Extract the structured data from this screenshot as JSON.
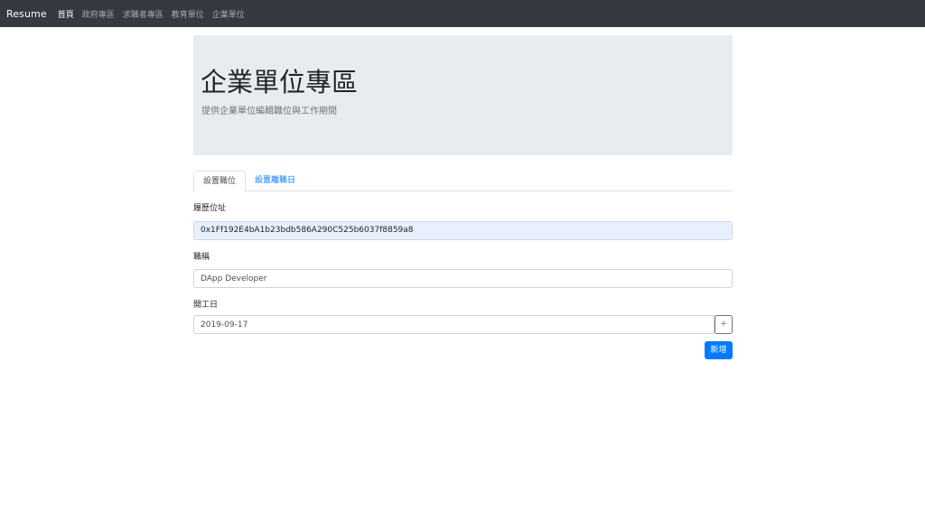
{
  "nav": {
    "brand": "Resume",
    "links": [
      {
        "label": "首頁",
        "active": true
      },
      {
        "label": "政府專區",
        "active": false
      },
      {
        "label": "求職者專區",
        "active": false
      },
      {
        "label": "教育單位",
        "active": false
      },
      {
        "label": "企業單位",
        "active": false
      }
    ]
  },
  "jumbotron": {
    "title": "企業單位專區",
    "subtitle": "提供企業單位編輯職位與工作期間"
  },
  "tabs": [
    {
      "label": "設置職位",
      "active": true
    },
    {
      "label": "設置離職日",
      "active": false
    }
  ],
  "form": {
    "address_label": "履歷位址",
    "address_value": "0x1Ff192E4bA1b23bdb586A290C525b6037f8859a8",
    "title_label": "職稱",
    "title_value": "DApp Developer",
    "start_label": "開工日",
    "start_value": "2019-09-17",
    "date_button": "+",
    "submit_label": "新增"
  },
  "colors": {
    "navbar": "#343a40",
    "primary": "#007bff",
    "jumbotron": "#e9ecef",
    "autofill": "#e8f0fe"
  }
}
